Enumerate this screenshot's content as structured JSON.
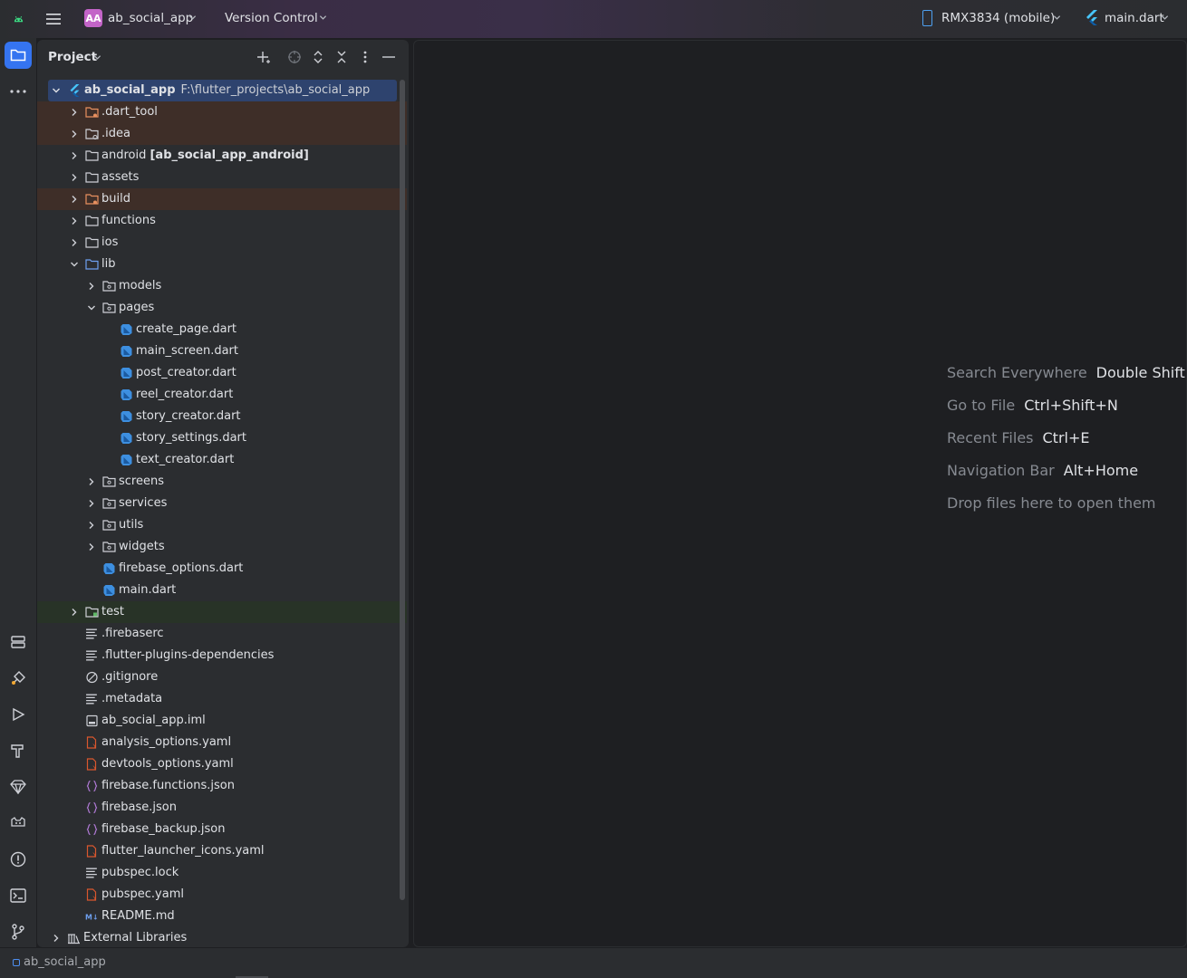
{
  "titlebar": {
    "project_badge": "AA",
    "project_name": "ab_social_app",
    "vcs": "Version Control",
    "device": "RMX3834 (mobile)",
    "run_config": "main.dart"
  },
  "panel": {
    "title": "Project"
  },
  "tree": {
    "root_name": "ab_social_app",
    "root_path": "F:\\flutter_projects\\ab_social_app",
    "items": [
      {
        "label": ".dart_tool",
        "suffix": "",
        "depth": 1,
        "arrow": "right",
        "icon": "folder-excluded",
        "style": "excluded"
      },
      {
        "label": ".idea",
        "suffix": "",
        "depth": 1,
        "arrow": "right",
        "icon": "folder-config",
        "style": "excluded"
      },
      {
        "label": "android",
        "suffix": "[ab_social_app_android]",
        "depth": 1,
        "arrow": "right",
        "icon": "folder",
        "style": ""
      },
      {
        "label": "assets",
        "suffix": "",
        "depth": 1,
        "arrow": "right",
        "icon": "folder",
        "style": ""
      },
      {
        "label": "build",
        "suffix": "",
        "depth": 1,
        "arrow": "right",
        "icon": "folder-excluded",
        "style": "excluded"
      },
      {
        "label": "functions",
        "suffix": "",
        "depth": 1,
        "arrow": "right",
        "icon": "folder",
        "style": ""
      },
      {
        "label": "ios",
        "suffix": "",
        "depth": 1,
        "arrow": "right",
        "icon": "folder",
        "style": ""
      },
      {
        "label": "lib",
        "suffix": "",
        "depth": 1,
        "arrow": "down",
        "icon": "folder-source",
        "style": ""
      },
      {
        "label": "models",
        "suffix": "",
        "depth": 2,
        "arrow": "right",
        "icon": "folder-package",
        "style": ""
      },
      {
        "label": "pages",
        "suffix": "",
        "depth": 2,
        "arrow": "down",
        "icon": "folder-package",
        "style": ""
      },
      {
        "label": "create_page.dart",
        "suffix": "",
        "depth": 3,
        "arrow": "",
        "icon": "dart-file",
        "style": ""
      },
      {
        "label": "main_screen.dart",
        "suffix": "",
        "depth": 3,
        "arrow": "",
        "icon": "dart-file",
        "style": ""
      },
      {
        "label": "post_creator.dart",
        "suffix": "",
        "depth": 3,
        "arrow": "",
        "icon": "dart-file",
        "style": ""
      },
      {
        "label": "reel_creator.dart",
        "suffix": "",
        "depth": 3,
        "arrow": "",
        "icon": "dart-file",
        "style": ""
      },
      {
        "label": "story_creator.dart",
        "suffix": "",
        "depth": 3,
        "arrow": "",
        "icon": "dart-file",
        "style": ""
      },
      {
        "label": "story_settings.dart",
        "suffix": "",
        "depth": 3,
        "arrow": "",
        "icon": "dart-file",
        "style": ""
      },
      {
        "label": "text_creator.dart",
        "suffix": "",
        "depth": 3,
        "arrow": "",
        "icon": "dart-file",
        "style": ""
      },
      {
        "label": "screens",
        "suffix": "",
        "depth": 2,
        "arrow": "right",
        "icon": "folder-package",
        "style": ""
      },
      {
        "label": "services",
        "suffix": "",
        "depth": 2,
        "arrow": "right",
        "icon": "folder-package",
        "style": ""
      },
      {
        "label": "utils",
        "suffix": "",
        "depth": 2,
        "arrow": "right",
        "icon": "folder-package",
        "style": ""
      },
      {
        "label": "widgets",
        "suffix": "",
        "depth": 2,
        "arrow": "right",
        "icon": "folder-package",
        "style": ""
      },
      {
        "label": "firebase_options.dart",
        "suffix": "",
        "depth": 2,
        "arrow": "",
        "icon": "dart-file",
        "style": ""
      },
      {
        "label": "main.dart",
        "suffix": "",
        "depth": 2,
        "arrow": "",
        "icon": "dart-file",
        "style": ""
      },
      {
        "label": "test",
        "suffix": "",
        "depth": 1,
        "arrow": "right",
        "icon": "folder-test",
        "style": "test"
      },
      {
        "label": ".firebaserc",
        "suffix": "",
        "depth": 1,
        "arrow": "",
        "icon": "text-file",
        "style": ""
      },
      {
        "label": ".flutter-plugins-dependencies",
        "suffix": "",
        "depth": 1,
        "arrow": "",
        "icon": "text-file",
        "style": ""
      },
      {
        "label": ".gitignore",
        "suffix": "",
        "depth": 1,
        "arrow": "",
        "icon": "ignore-file",
        "style": ""
      },
      {
        "label": ".metadata",
        "suffix": "",
        "depth": 1,
        "arrow": "",
        "icon": "text-file",
        "style": ""
      },
      {
        "label": "ab_social_app.iml",
        "suffix": "",
        "depth": 1,
        "arrow": "",
        "icon": "module-file",
        "style": ""
      },
      {
        "label": "analysis_options.yaml",
        "suffix": "",
        "depth": 1,
        "arrow": "",
        "icon": "yaml-file",
        "style": ""
      },
      {
        "label": "devtools_options.yaml",
        "suffix": "",
        "depth": 1,
        "arrow": "",
        "icon": "yaml-file",
        "style": ""
      },
      {
        "label": "firebase.functions.json",
        "suffix": "",
        "depth": 1,
        "arrow": "",
        "icon": "json-file",
        "style": ""
      },
      {
        "label": "firebase.json",
        "suffix": "",
        "depth": 1,
        "arrow": "",
        "icon": "json-file",
        "style": ""
      },
      {
        "label": "firebase_backup.json",
        "suffix": "",
        "depth": 1,
        "arrow": "",
        "icon": "json-file",
        "style": ""
      },
      {
        "label": "flutter_launcher_icons.yaml",
        "suffix": "",
        "depth": 1,
        "arrow": "",
        "icon": "yaml-file",
        "style": ""
      },
      {
        "label": "pubspec.lock",
        "suffix": "",
        "depth": 1,
        "arrow": "",
        "icon": "text-file",
        "style": ""
      },
      {
        "label": "pubspec.yaml",
        "suffix": "",
        "depth": 1,
        "arrow": "",
        "icon": "yaml-file",
        "style": ""
      },
      {
        "label": "README.md",
        "suffix": "",
        "depth": 1,
        "arrow": "",
        "icon": "markdown-file",
        "style": ""
      },
      {
        "label": "External Libraries",
        "suffix": "",
        "depth": 0,
        "arrow": "right",
        "icon": "library",
        "style": ""
      }
    ]
  },
  "editor_hints": [
    {
      "action": "Search Everywhere",
      "shortcut": "Double Shift"
    },
    {
      "action": "Go to File",
      "shortcut": "Ctrl+Shift+N"
    },
    {
      "action": "Recent Files",
      "shortcut": "Ctrl+E"
    },
    {
      "action": "Navigation Bar",
      "shortcut": "Alt+Home"
    },
    {
      "action": "Drop files here to open them",
      "shortcut": ""
    }
  ],
  "statusbar": {
    "project": "ab_social_app"
  },
  "colors": {
    "accent": "#3574f0",
    "selection": "#2e436e",
    "excluded_bg": "#3e2e28",
    "test_bg": "#283327",
    "dart_blue": "#3d8fe0",
    "yaml_red": "#d9572e",
    "json_purple": "#b07ad6"
  }
}
